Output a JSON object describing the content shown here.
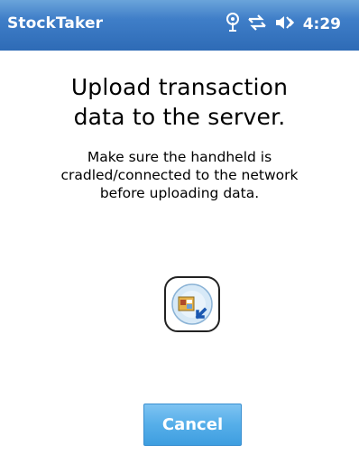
{
  "titlebar": {
    "app_title": "StockTaker",
    "clock": "4:29",
    "icons": [
      "antenna-icon",
      "connectivity-icon",
      "volume-icon"
    ]
  },
  "content": {
    "heading_line1": "Upload transaction",
    "heading_line2": "data to the server.",
    "message_line1": "Make sure the handheld is",
    "message_line2": "cradled/connected to the network",
    "message_line3": "before uploading data."
  },
  "actions": {
    "cancel_label": "Cancel"
  },
  "colors": {
    "titlebar": "#3f7ec8",
    "button": "#55aee9"
  }
}
